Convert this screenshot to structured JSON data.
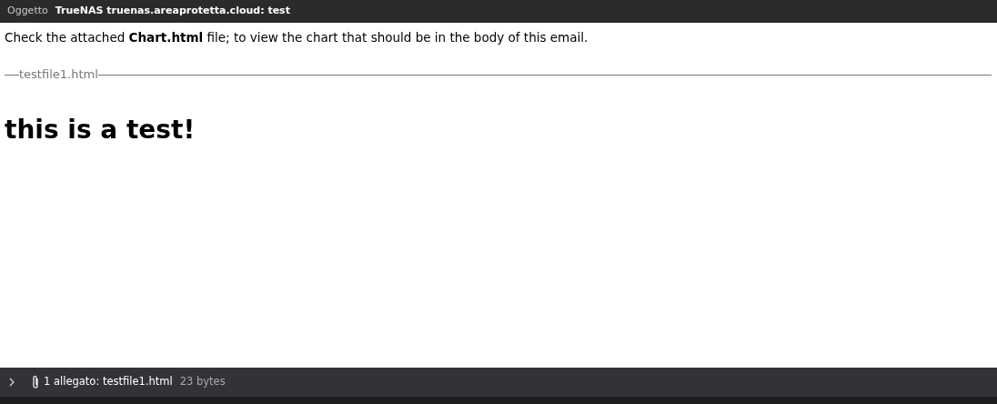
{
  "header": {
    "label": "Oggetto",
    "subject": "TrueNAS truenas.areaprotetta.cloud: test"
  },
  "body": {
    "intro": "Check the attached **Chart.html** file; to view the chart that should be in the body of this email.",
    "attachment_legend": "testfile1.html",
    "heading": "this is a test!"
  },
  "attachments_bar": {
    "expanded": false,
    "summary": "1 allegato: testfile1.html",
    "size": "23 bytes"
  }
}
